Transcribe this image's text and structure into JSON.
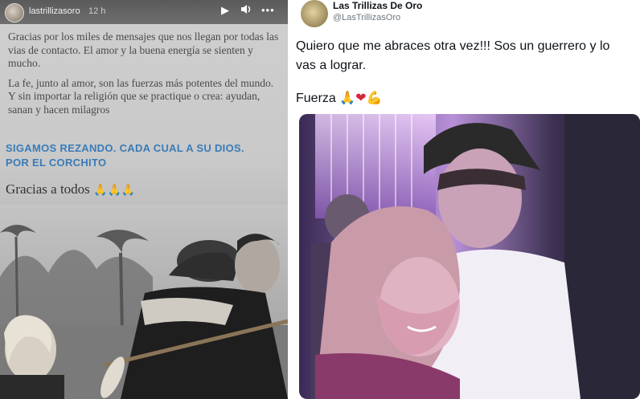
{
  "story": {
    "username": "lastrillizasoro",
    "time": "12 h",
    "paragraphs": [
      "Gracias por los miles de mensajes que nos llegan por todas las vias de contacto. El amor y la buena energía se sienten y mucho.",
      "La fe, junto al amor, son las fuerzas más potentes del mundo. Y sin importar la religión que se practique o crea: ayudan, sanan y hacen milagros"
    ],
    "highlight_line1": "SIGAMOS REZANDO. CADA CUAL A SU DIOS.",
    "highlight_line2": "POR EL CORCHITO",
    "thanks": "Gracias a todos",
    "thanks_emoji": "🙏🙏🙏",
    "icons": [
      "play-icon",
      "volume-icon",
      "more-icon"
    ]
  },
  "tweet": {
    "display_name": "Las Trillizas De Oro",
    "handle": "@LasTrillizasOro",
    "line1": "Quiero que me abraces otra vez!!! Sos un guerrero y lo",
    "line2": "vas a lograr.",
    "fuerza_word": "Fuerza",
    "fuerza_emoji1": "🙏",
    "fuerza_emoji2": "❤",
    "fuerza_emoji3": "💪"
  },
  "colors": {
    "story_highlight": "#3a7cb8",
    "tweet_text": "#0f1419",
    "tweet_handle": "#6e767d"
  }
}
